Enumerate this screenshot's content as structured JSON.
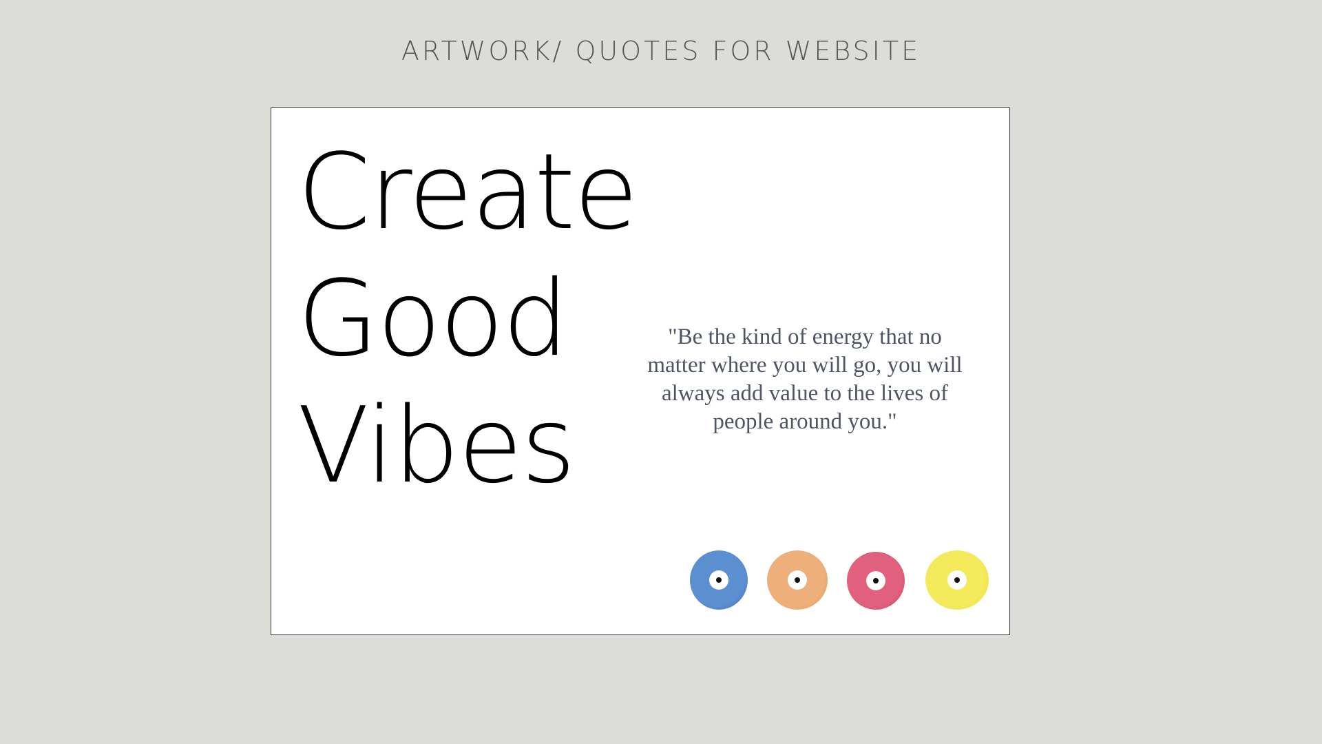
{
  "page": {
    "title": "ARTWORK/ QUOTES FOR WEBSITE"
  },
  "artwork": {
    "headline": [
      "Create",
      "Good",
      "Vibes"
    ],
    "quote": "\"Be the kind of energy that no matter where you will go, you will always add value to the lives of people around you.\"",
    "dots": [
      {
        "name": "blue",
        "color": "#5b8fcf",
        "edge": "#3f73b8"
      },
      {
        "name": "orange",
        "color": "#eeb07a",
        "edge": "#e59a5c"
      },
      {
        "name": "pink",
        "color": "#e0607e",
        "edge": "#cf4466"
      },
      {
        "name": "yellow",
        "color": "#f3ea5c",
        "edge": "#efe23a"
      }
    ]
  }
}
